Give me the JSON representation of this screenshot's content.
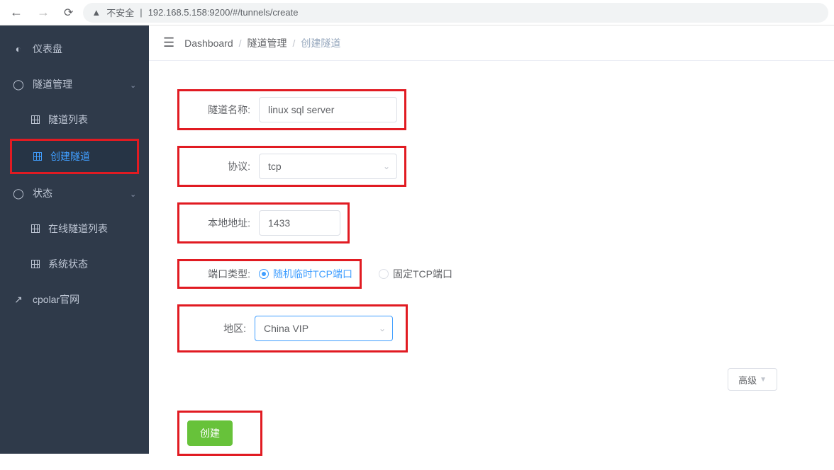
{
  "browser": {
    "security_label": "不安全",
    "url": "192.168.5.158:9200/#/tunnels/create"
  },
  "sidebar": {
    "items": [
      {
        "icon": "dashboard",
        "label": "仪表盘"
      },
      {
        "icon": "circle",
        "label": "隧道管理",
        "expandable": true
      },
      {
        "sub": true,
        "label": "隧道列表"
      },
      {
        "sub": true,
        "label": "创建隧道",
        "active": true
      },
      {
        "icon": "circle",
        "label": "状态",
        "expandable": true
      },
      {
        "sub": true,
        "label": "在线隧道列表"
      },
      {
        "sub": true,
        "label": "系统状态"
      },
      {
        "icon": "external",
        "label": "cpolar官网"
      }
    ]
  },
  "breadcrumb": [
    "Dashboard",
    "隧道管理",
    "创建隧道"
  ],
  "form": {
    "tunnel_name_label": "隧道名称:",
    "tunnel_name_value": "linux sql server",
    "protocol_label": "协议:",
    "protocol_value": "tcp",
    "local_addr_label": "本地地址:",
    "local_addr_value": "1433",
    "port_type_label": "端口类型:",
    "port_type_opt1": "随机临时TCP端口",
    "port_type_opt2": "固定TCP端口",
    "region_label": "地区:",
    "region_value": "China VIP",
    "advanced_label": "高级",
    "submit_label": "创建"
  }
}
